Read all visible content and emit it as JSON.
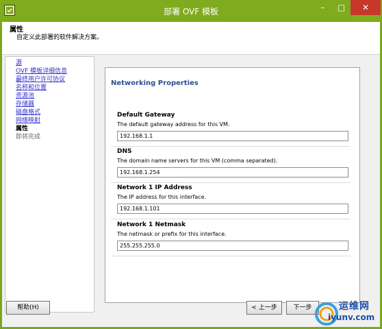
{
  "window": {
    "title": "部署 OVF 模板",
    "minimize_glyph": "–",
    "maximize_glyph": "□",
    "close_glyph": "✕",
    "accent": "#7fab1e"
  },
  "header": {
    "title": "属性",
    "subtitle": "自定义此部署的软件解决方案。"
  },
  "nav": {
    "items": [
      {
        "label": "源",
        "state": "link"
      },
      {
        "label": "OVF 模板详细信息",
        "state": "link"
      },
      {
        "label": "最终用户许可协议",
        "state": "link"
      },
      {
        "label": "名称和位置",
        "state": "link"
      },
      {
        "label": "资源池",
        "state": "link"
      },
      {
        "label": "存储器",
        "state": "link"
      },
      {
        "label": "磁盘格式",
        "state": "link"
      },
      {
        "label": "网络映射",
        "state": "link"
      },
      {
        "label": "属性",
        "state": "current"
      },
      {
        "label": "即将完成",
        "state": "future"
      }
    ]
  },
  "main": {
    "section_title": "Networking Properties",
    "properties": [
      {
        "label": "Default Gateway",
        "description": "The default gateway address for this VM.",
        "value": "192.168.1.1"
      },
      {
        "label": "DNS",
        "description": "The domain name servers for this VM (comma separated).",
        "value": "192.168.1.254"
      },
      {
        "label": "Network 1 IP Address",
        "description": "The IP address for this interface.",
        "value": "192.168.1.101"
      },
      {
        "label": "Network 1 Netmask",
        "description": "The netmask or prefix for this interface.",
        "value": "255.255.255.0"
      }
    ]
  },
  "footer": {
    "help_label": "帮助(H)",
    "back_label": "< 上一步",
    "next_label": "下一步"
  },
  "watermark": {
    "brand": "运维网",
    "url": "iyunv.com"
  }
}
